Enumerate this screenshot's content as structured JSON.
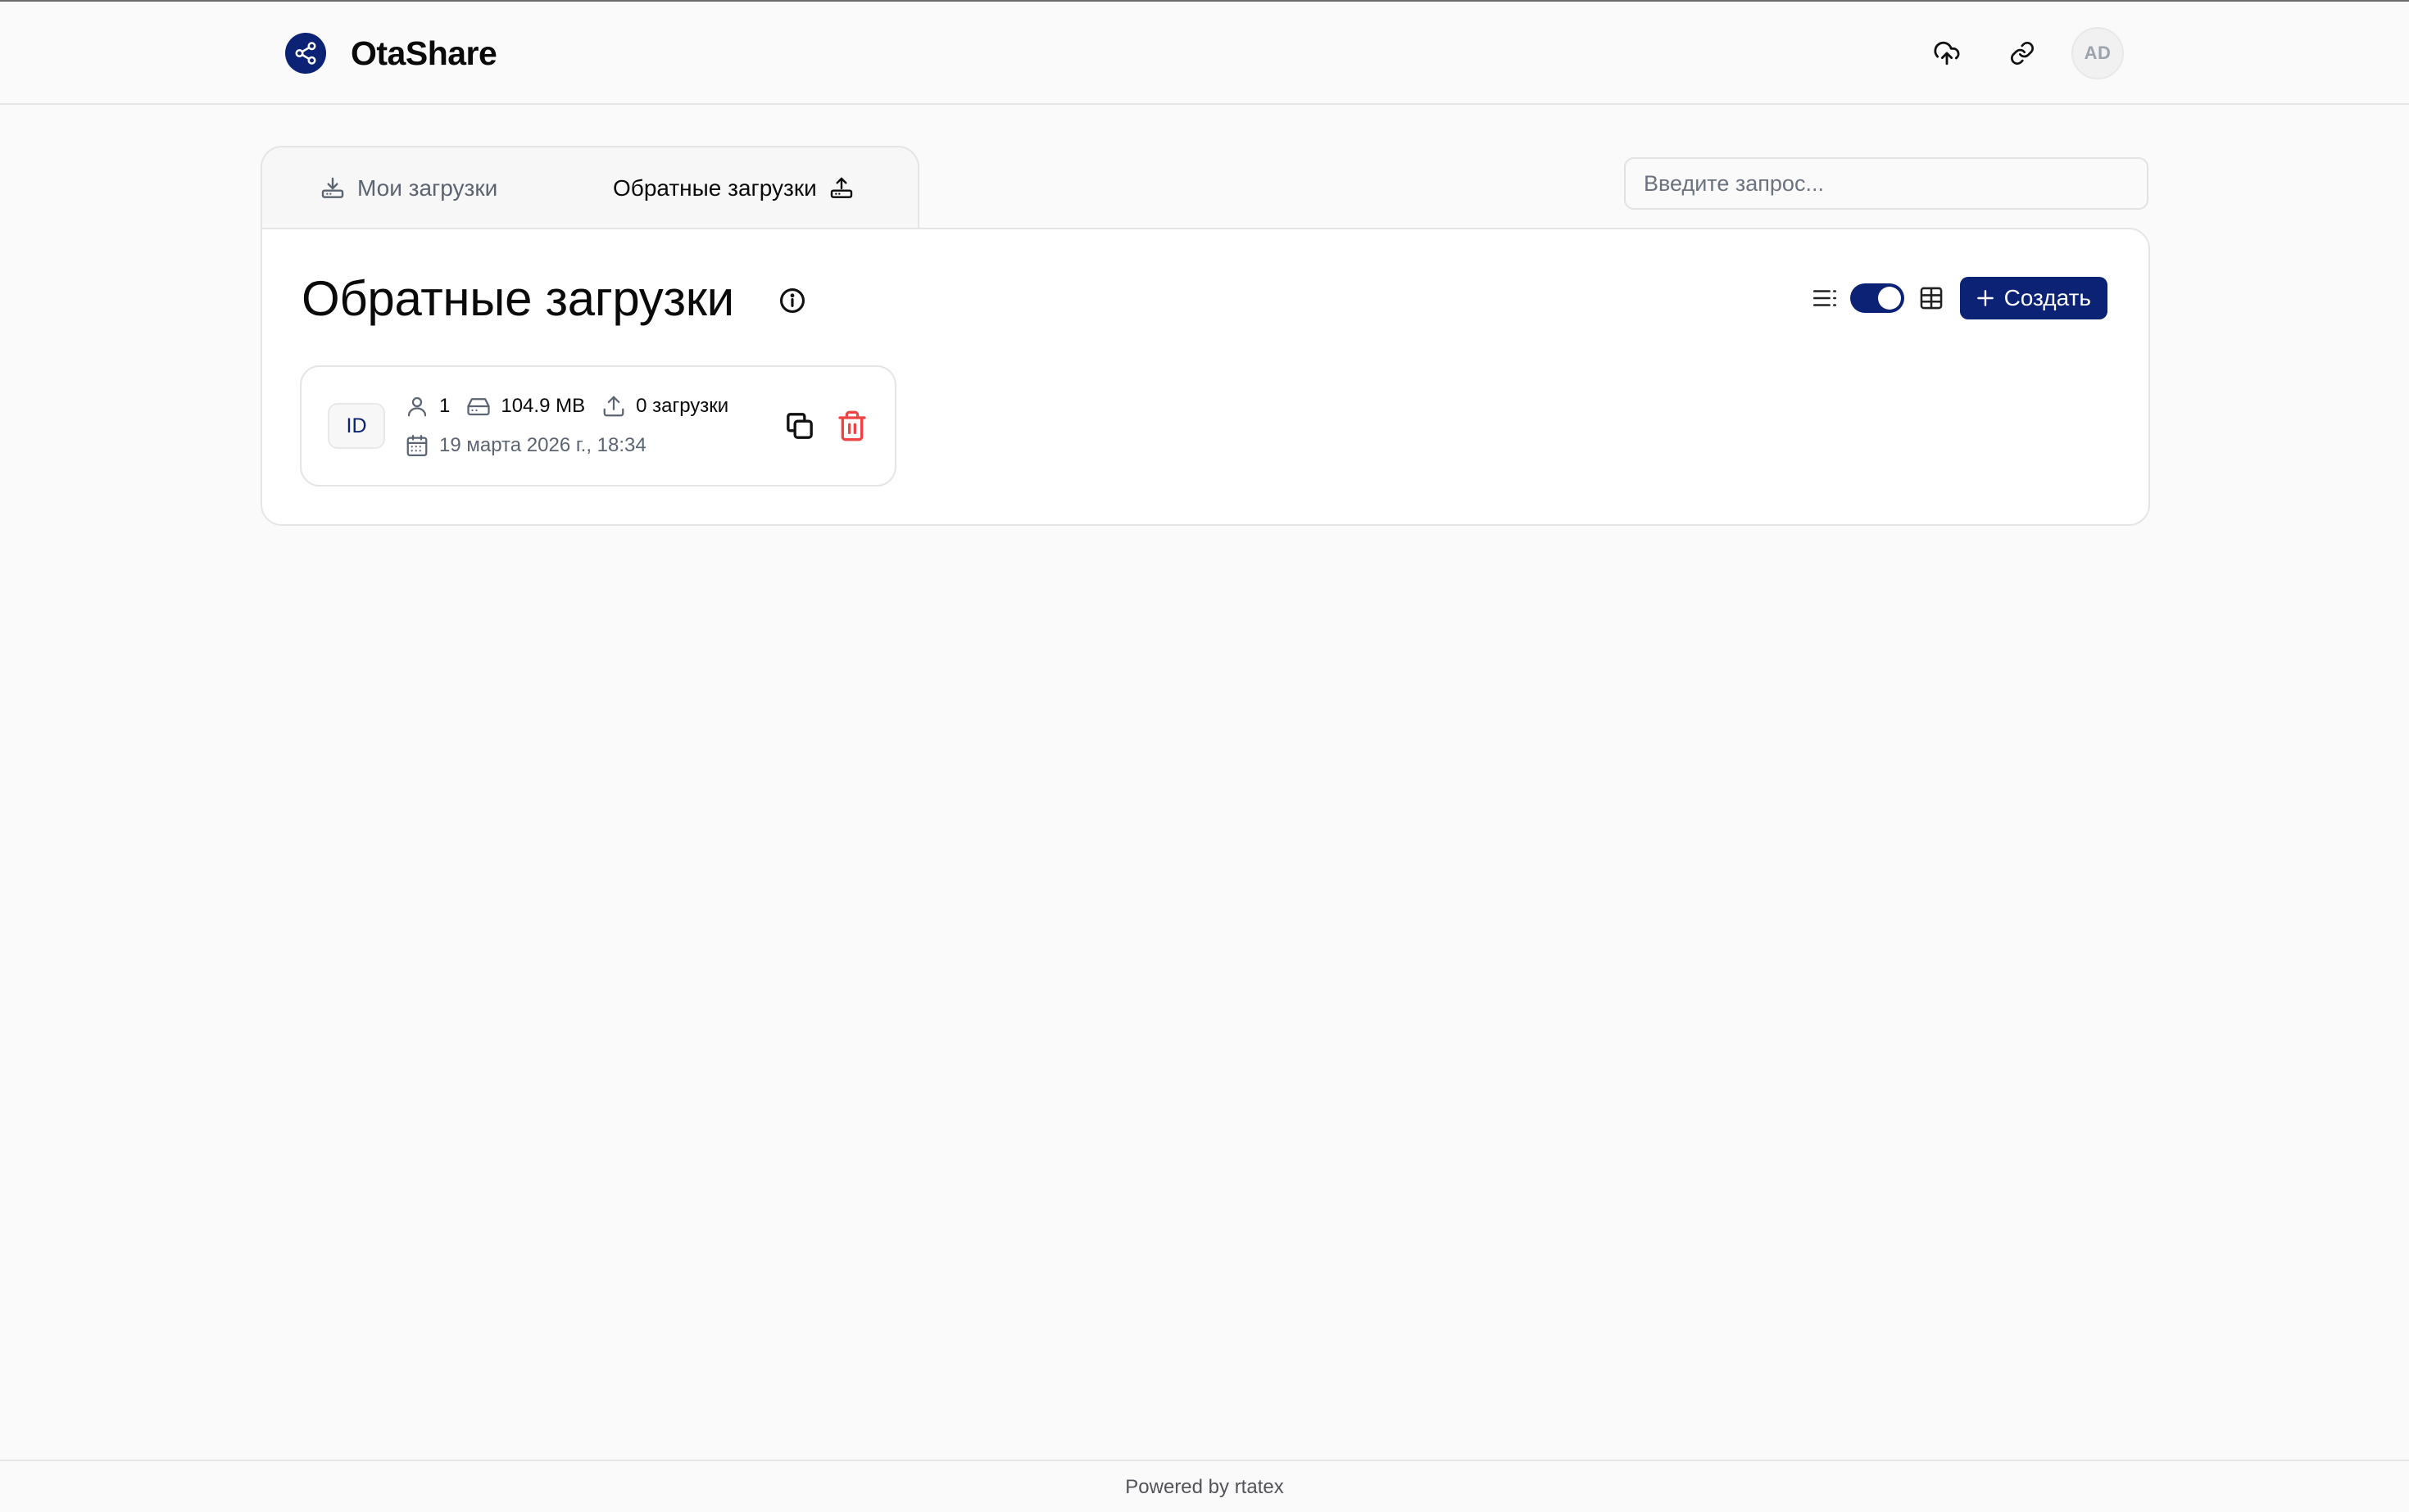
{
  "header": {
    "app_name": "OtaShare",
    "avatar_initials": "AD"
  },
  "tabs": [
    {
      "label": "Мои загрузки",
      "active": false
    },
    {
      "label": "Обратные загрузки",
      "active": true
    }
  ],
  "search": {
    "placeholder": "Введите запрос...",
    "value": ""
  },
  "main": {
    "title": "Обратные загрузки",
    "view_toggle_on": true,
    "create_label": "Создать"
  },
  "cards": [
    {
      "badge": "ID",
      "users": "1",
      "size": "104.9 MB",
      "uploads": "0 загрузки",
      "date": "19 марта 2026 г., 18:34"
    }
  ],
  "footer": {
    "text": "Powered by rtatex"
  },
  "colors": {
    "accent": "#0b2275",
    "danger": "#ef4444",
    "muted": "#5b6473"
  }
}
